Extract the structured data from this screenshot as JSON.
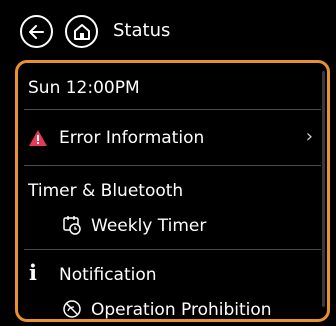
{
  "header": {
    "title": "Status",
    "back_icon": "back-arrow-icon",
    "home_icon": "home-icon"
  },
  "list": {
    "clock": "Sun 12:00PM",
    "error_label": "Error Information",
    "timer_section": "Timer & Bluetooth",
    "weekly_timer": "Weekly Timer",
    "notification_section": "Notification",
    "operation_prohibition": "Operation Prohibition"
  },
  "colors": {
    "accent": "#e8912f",
    "warning": "#e63a55"
  }
}
